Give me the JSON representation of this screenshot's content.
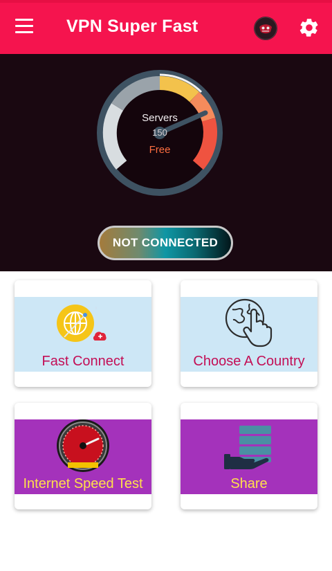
{
  "header": {
    "title": "VPN Super Fast",
    "background": "#f5144e",
    "menu_icon": "hamburger-menu-icon",
    "account_icon": "avatar-icon",
    "settings_icon": "gear-icon"
  },
  "gauge": {
    "servers_label": "Servers",
    "servers_count": "150",
    "plan_label": "Free"
  },
  "status": {
    "label": "NOT CONNECTED"
  },
  "cards": [
    {
      "label": "Fast Connect",
      "icon": "globe-rocket-icon"
    },
    {
      "label": "Choose A Country",
      "icon": "globe-touch-icon"
    },
    {
      "label": "Internet Speed Test",
      "icon": "speedometer-icon"
    },
    {
      "label": "Share",
      "icon": "server-hand-icon"
    }
  ],
  "colors": {
    "accent": "#f5144e",
    "hero_bg": "#1a0811",
    "card_blue": "#cde7f6",
    "card_purple": "#a432bb",
    "label_red": "#c30e55",
    "label_yellow": "#ffe04b"
  }
}
